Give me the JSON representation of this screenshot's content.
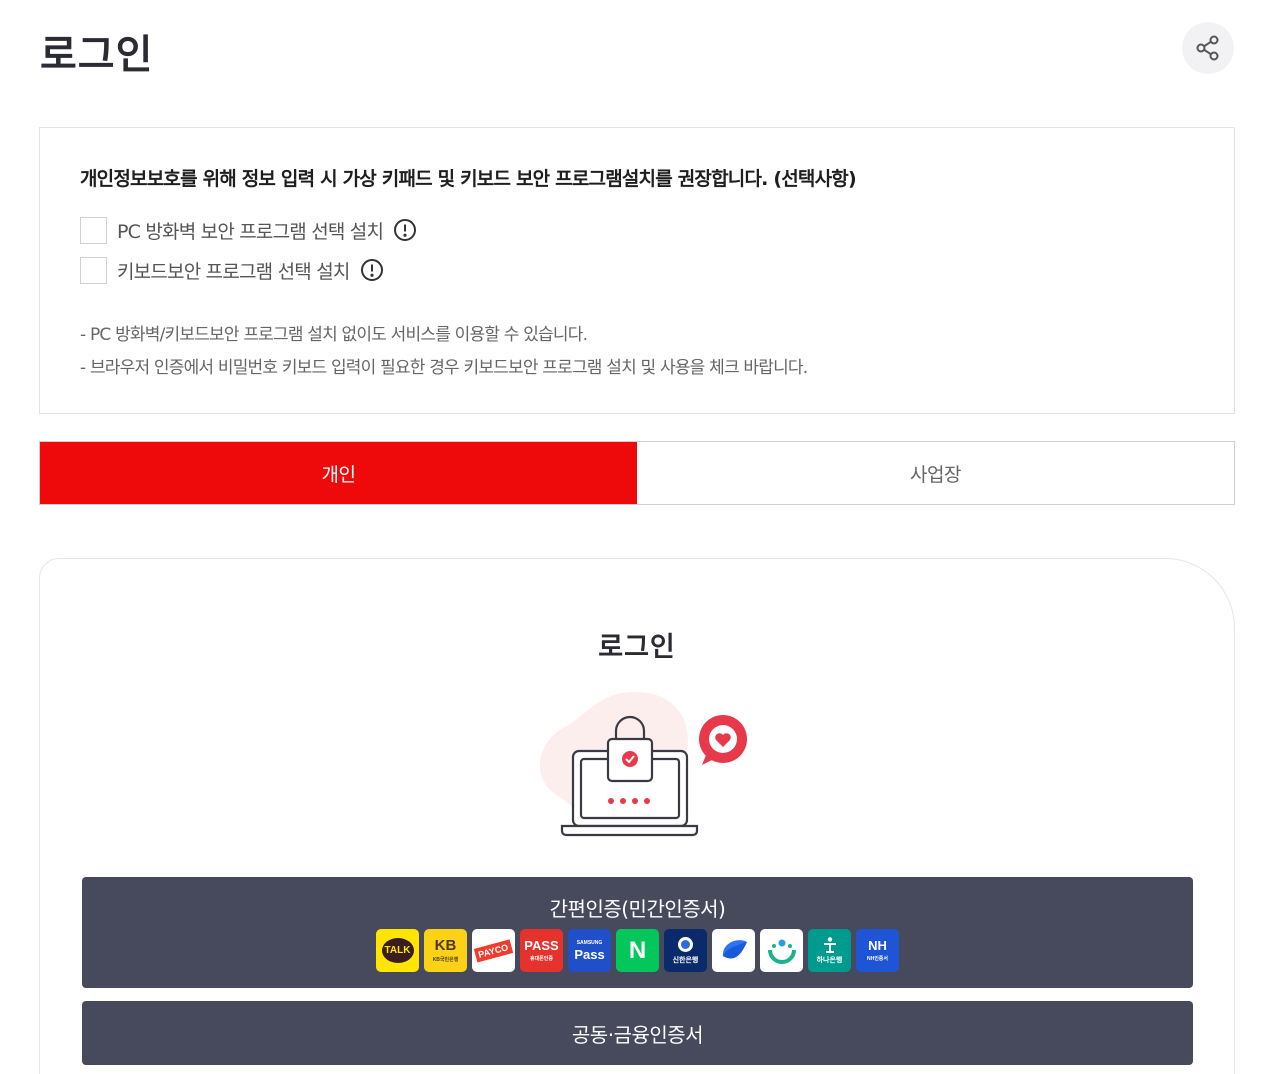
{
  "header": {
    "title": "로그인",
    "share_icon": "share-icon"
  },
  "notice": {
    "title": "개인정보보호를 위해 정보 입력 시 가상 키패드 및 키보드 보안 프로그램설치를 권장합니다. (선택사항)",
    "options": [
      {
        "label": "PC 방화벽 보안 프로그램 선택 설치",
        "checked": false
      },
      {
        "label": "키보드보안 프로그램 선택 설치",
        "checked": false
      }
    ],
    "notes": [
      "- PC 방화벽/키보드보안 프로그램 설치 없이도 서비스를 이용할 수 있습니다.",
      "- 브라우저 인증에서 비밀번호 키보드 입력이 필요한 경우 키보드보안 프로그램 설치 및 사용을 체크 바랍니다."
    ]
  },
  "tabs": [
    {
      "label": "개인",
      "active": true
    },
    {
      "label": "사업장",
      "active": false
    }
  ],
  "login": {
    "title": "로그인",
    "easy_auth_label": "간편인증(민간인증서)",
    "providers": [
      {
        "name": "kakao-talk",
        "text": "TALK",
        "sub": ""
      },
      {
        "name": "kb-bank",
        "text": "KB",
        "sub": "KB국민은행"
      },
      {
        "name": "payco",
        "text": "PAYCO",
        "sub": ""
      },
      {
        "name": "pass",
        "text": "PASS",
        "sub": "휴대폰인증"
      },
      {
        "name": "samsung-pass",
        "text": "Pass",
        "sub": "SAMSUNG"
      },
      {
        "name": "naver",
        "text": "N",
        "sub": ""
      },
      {
        "name": "shinhan-bank",
        "text": "",
        "sub": "신한은행"
      },
      {
        "name": "toss",
        "text": "",
        "sub": ""
      },
      {
        "name": "bank-app",
        "text": "",
        "sub": ""
      },
      {
        "name": "hana-bank",
        "text": "",
        "sub": "하나은행"
      },
      {
        "name": "nh-bank",
        "text": "NH",
        "sub": "NH인증서"
      }
    ],
    "cert_label": "공동·금융인증서"
  },
  "colors": {
    "accent": "#ee0a0a",
    "button_bg": "#474a5c"
  }
}
